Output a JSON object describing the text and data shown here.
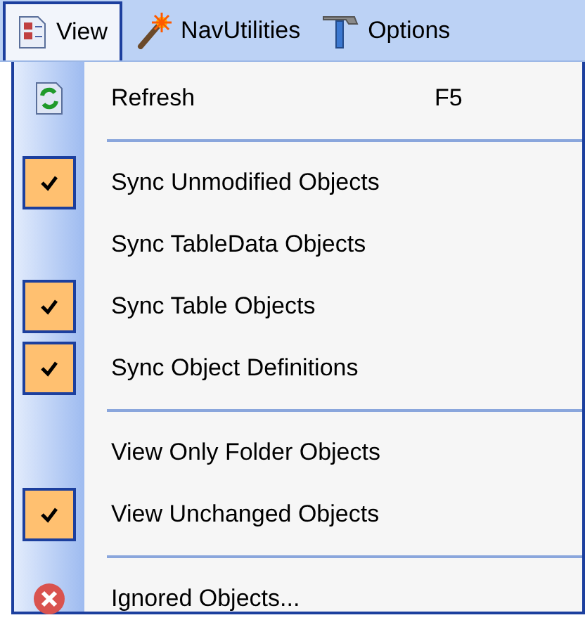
{
  "menubar": [
    {
      "label": "View",
      "selected": true
    },
    {
      "label": "NavUtilities",
      "selected": false
    },
    {
      "label": "Options",
      "selected": false
    }
  ],
  "menu": [
    {
      "kind": "command",
      "label": "Refresh",
      "shortcut": "F5"
    },
    {
      "kind": "separator"
    },
    {
      "kind": "toggle",
      "label": "Sync Unmodified Objects",
      "checked": true
    },
    {
      "kind": "toggle",
      "label": "Sync TableData Objects",
      "checked": false
    },
    {
      "kind": "toggle",
      "label": "Sync Table Objects",
      "checked": true
    },
    {
      "kind": "toggle",
      "label": "Sync Object Definitions",
      "checked": true
    },
    {
      "kind": "separator"
    },
    {
      "kind": "toggle",
      "label": "View Only Folder Objects",
      "checked": false
    },
    {
      "kind": "toggle",
      "label": "View Unchanged Objects",
      "checked": true
    },
    {
      "kind": "separator"
    },
    {
      "kind": "command",
      "label": "Ignored Objects..."
    }
  ]
}
